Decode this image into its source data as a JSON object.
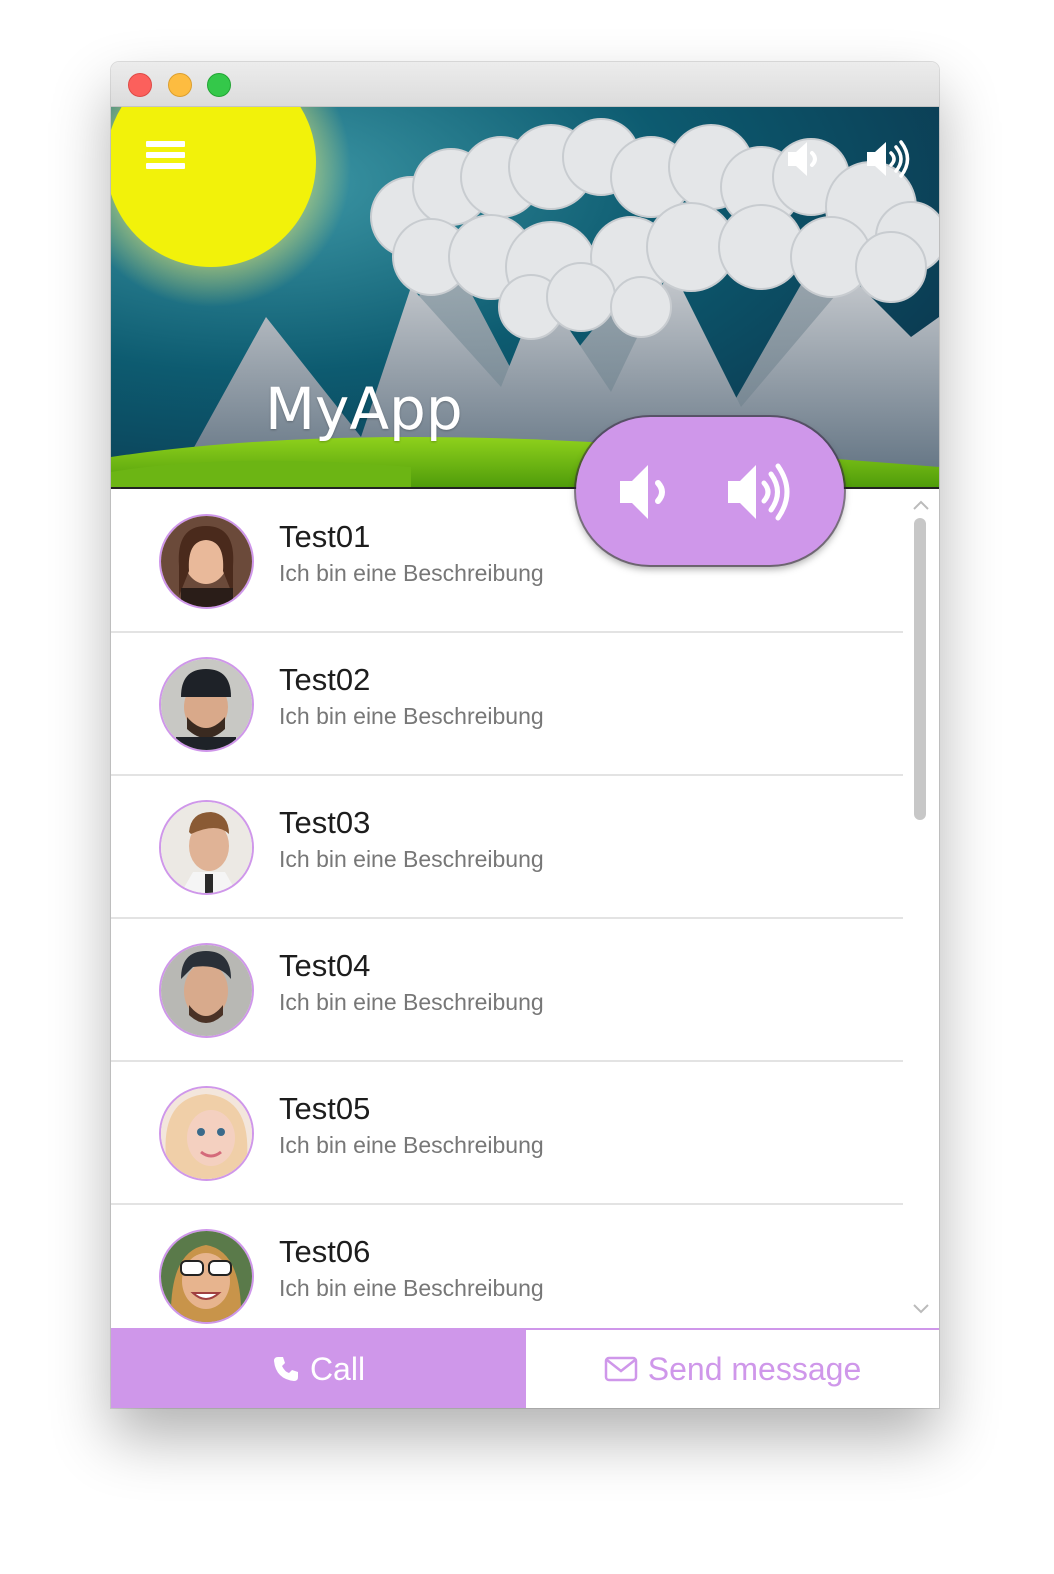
{
  "app": {
    "title": "MyApp"
  },
  "header": {
    "icons": [
      "hamburger-menu-icon",
      "volume-down-icon",
      "volume-up-icon"
    ]
  },
  "fab": {
    "icons": [
      "volume-down-icon",
      "volume-up-icon"
    ]
  },
  "contacts": [
    {
      "name": "Test01",
      "description": "Ich bin eine Beschreibung"
    },
    {
      "name": "Test02",
      "description": "Ich bin eine Beschreibung"
    },
    {
      "name": "Test03",
      "description": "Ich bin eine Beschreibung"
    },
    {
      "name": "Test04",
      "description": "Ich bin eine Beschreibung"
    },
    {
      "name": "Test05",
      "description": "Ich bin eine Beschreibung"
    },
    {
      "name": "Test06",
      "description": "Ich bin eine Beschreibung"
    }
  ],
  "actions": {
    "call_label": "Call",
    "call_icon": "phone-icon",
    "message_label": "Send message",
    "message_icon": "envelope-icon"
  },
  "colors": {
    "accent": "#cf97ea",
    "sun": "#f2f20a",
    "sky": "#0f5a6e",
    "grass": "#7fc41a"
  }
}
